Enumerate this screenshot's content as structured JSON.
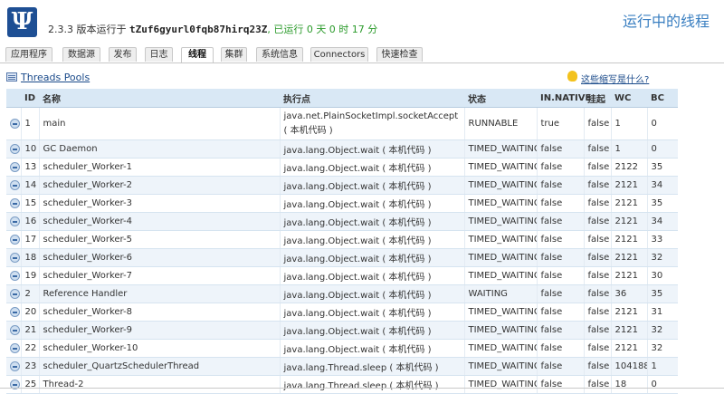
{
  "header": {
    "logo_glyph": "Ψ",
    "version_prefix": "2.3.3 版本运行于",
    "app_id": "tZuf6gyurl0fqb87hirq23Z",
    "uptime": ", 已运行 0 天 0 时 17 分",
    "page_title": "运行中的线程"
  },
  "tabs": [
    "应用程序",
    "数据源",
    "发布",
    "日志",
    "线程",
    "集群",
    "系统信息",
    "Connectors",
    "快速检查"
  ],
  "active_tab": "线程",
  "toolbar": {
    "threads_pools_label": "Threads Pools",
    "help_label": "这些缩写是什么?"
  },
  "table": {
    "columns": [
      "ID",
      "名称",
      "执行点",
      "状态",
      "IN.NATIVE",
      "挂起",
      "WC",
      "BC"
    ],
    "rows": [
      {
        "id": "1",
        "name": "main",
        "exec": "java.net.PlainSocketImpl.socketAccept ( 本机代码 )",
        "state": "RUNNABLE",
        "native": "true",
        "suspended": "false",
        "wc": "1",
        "bc": "0"
      },
      {
        "id": "10",
        "name": "GC Daemon",
        "exec": "java.lang.Object.wait ( 本机代码 )",
        "state": "TIMED_WAITING",
        "native": "false",
        "suspended": "false",
        "wc": "1",
        "bc": "0"
      },
      {
        "id": "13",
        "name": "scheduler_Worker-1",
        "exec": "java.lang.Object.wait ( 本机代码 )",
        "state": "TIMED_WAITING",
        "native": "false",
        "suspended": "false",
        "wc": "2122",
        "bc": "35"
      },
      {
        "id": "14",
        "name": "scheduler_Worker-2",
        "exec": "java.lang.Object.wait ( 本机代码 )",
        "state": "TIMED_WAITING",
        "native": "false",
        "suspended": "false",
        "wc": "2121",
        "bc": "34"
      },
      {
        "id": "15",
        "name": "scheduler_Worker-3",
        "exec": "java.lang.Object.wait ( 本机代码 )",
        "state": "TIMED_WAITING",
        "native": "false",
        "suspended": "false",
        "wc": "2121",
        "bc": "35"
      },
      {
        "id": "16",
        "name": "scheduler_Worker-4",
        "exec": "java.lang.Object.wait ( 本机代码 )",
        "state": "TIMED_WAITING",
        "native": "false",
        "suspended": "false",
        "wc": "2121",
        "bc": "34"
      },
      {
        "id": "17",
        "name": "scheduler_Worker-5",
        "exec": "java.lang.Object.wait ( 本机代码 )",
        "state": "TIMED_WAITING",
        "native": "false",
        "suspended": "false",
        "wc": "2121",
        "bc": "33"
      },
      {
        "id": "18",
        "name": "scheduler_Worker-6",
        "exec": "java.lang.Object.wait ( 本机代码 )",
        "state": "TIMED_WAITING",
        "native": "false",
        "suspended": "false",
        "wc": "2121",
        "bc": "32"
      },
      {
        "id": "19",
        "name": "scheduler_Worker-7",
        "exec": "java.lang.Object.wait ( 本机代码 )",
        "state": "TIMED_WAITING",
        "native": "false",
        "suspended": "false",
        "wc": "2121",
        "bc": "30"
      },
      {
        "id": "2",
        "name": "Reference Handler",
        "exec": "java.lang.Object.wait ( 本机代码 )",
        "state": "WAITING",
        "native": "false",
        "suspended": "false",
        "wc": "36",
        "bc": "35"
      },
      {
        "id": "20",
        "name": "scheduler_Worker-8",
        "exec": "java.lang.Object.wait ( 本机代码 )",
        "state": "TIMED_WAITING",
        "native": "false",
        "suspended": "false",
        "wc": "2121",
        "bc": "31"
      },
      {
        "id": "21",
        "name": "scheduler_Worker-9",
        "exec": "java.lang.Object.wait ( 本机代码 )",
        "state": "TIMED_WAITING",
        "native": "false",
        "suspended": "false",
        "wc": "2121",
        "bc": "32"
      },
      {
        "id": "22",
        "name": "scheduler_Worker-10",
        "exec": "java.lang.Object.wait ( 本机代码 )",
        "state": "TIMED_WAITING",
        "native": "false",
        "suspended": "false",
        "wc": "2121",
        "bc": "32"
      },
      {
        "id": "23",
        "name": "scheduler_QuartzSchedulerThread",
        "exec": "java.lang.Thread.sleep ( 本机代码 )",
        "state": "TIMED_WAITING",
        "native": "false",
        "suspended": "false",
        "wc": "104188",
        "bc": "1"
      },
      {
        "id": "25",
        "name": "Thread-2",
        "exec": "java.lang.Thread.sleep ( 本机代码 )",
        "state": "TIMED_WAITING",
        "native": "false",
        "suspended": "false",
        "wc": "18",
        "bc": "0"
      }
    ]
  },
  "icons": {
    "thread_row_icon": "thread-icon",
    "threads_pools_icon": "threads-pools-icon",
    "help_icon": "lightbulb-icon"
  },
  "colors": {
    "accent": "#3a7fc1",
    "uptime": "#2a9a2a",
    "header_row": "#d9e8f5",
    "alt_row": "#eef4fa"
  }
}
